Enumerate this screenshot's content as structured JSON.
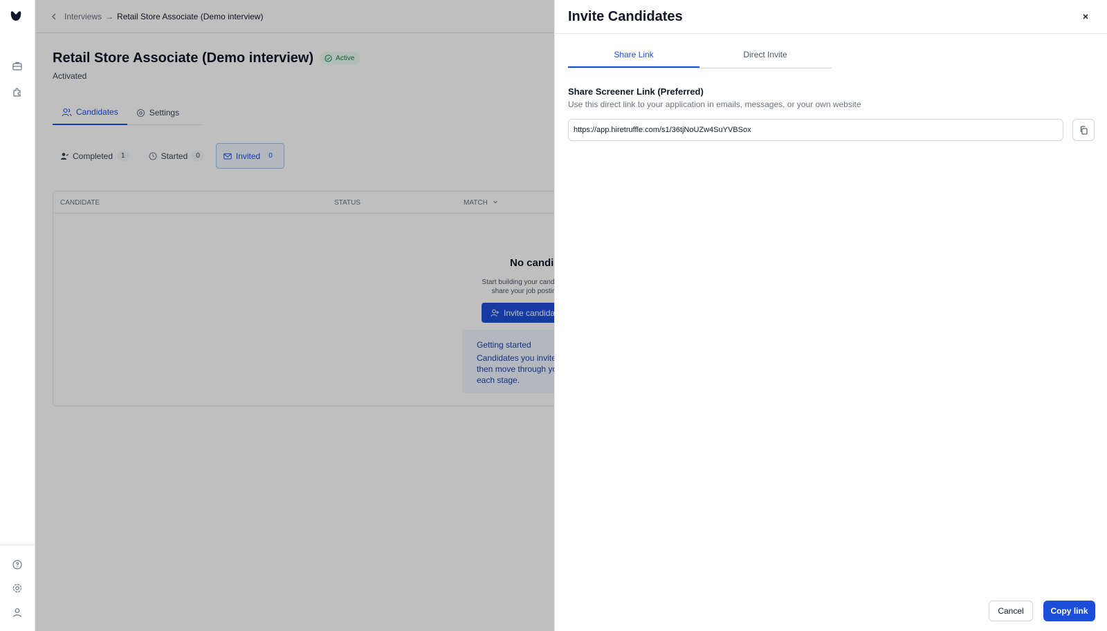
{
  "breadcrumb": {
    "parent": "Interviews",
    "current": "Retail Store Associate (Demo interview)"
  },
  "page": {
    "title": "Retail Store Associate (Demo interview)",
    "status_badge": "Active",
    "subtitle": "Activated"
  },
  "tabs": [
    {
      "label": "Candidates"
    },
    {
      "label": "Settings"
    }
  ],
  "filters": [
    {
      "label": "Completed",
      "count": "1"
    },
    {
      "label": "Started",
      "count": "0"
    },
    {
      "label": "Invited",
      "count": "0"
    }
  ],
  "table": {
    "headers": {
      "candidate": "CANDIDATE",
      "status": "STATUS",
      "match": "MATCH"
    },
    "empty_title": "No candi",
    "empty_text_line1": "Start building your candidat",
    "empty_text_line2": "share your job postin",
    "invite_button": "Invite candida",
    "getting_started": {
      "heading": "Getting started",
      "line1": "Candidates you invite",
      "line2": "then move through yo",
      "line3": "each stage."
    }
  },
  "drawer": {
    "title": "Invite Candidates",
    "tabs": [
      {
        "label": "Share Link"
      },
      {
        "label": "Direct Invite"
      }
    ],
    "section_title": "Share Screener Link (Preferred)",
    "section_desc": "Use this direct link to your application in emails, messages, or your own website",
    "link_value": "https://app.hiretruffle.com/s1/36tjNoUZw4SuYVBSox",
    "cancel_label": "Cancel",
    "copy_label": "Copy link"
  },
  "colors": {
    "accent": "#1d4ed8",
    "success": "#15803d"
  }
}
